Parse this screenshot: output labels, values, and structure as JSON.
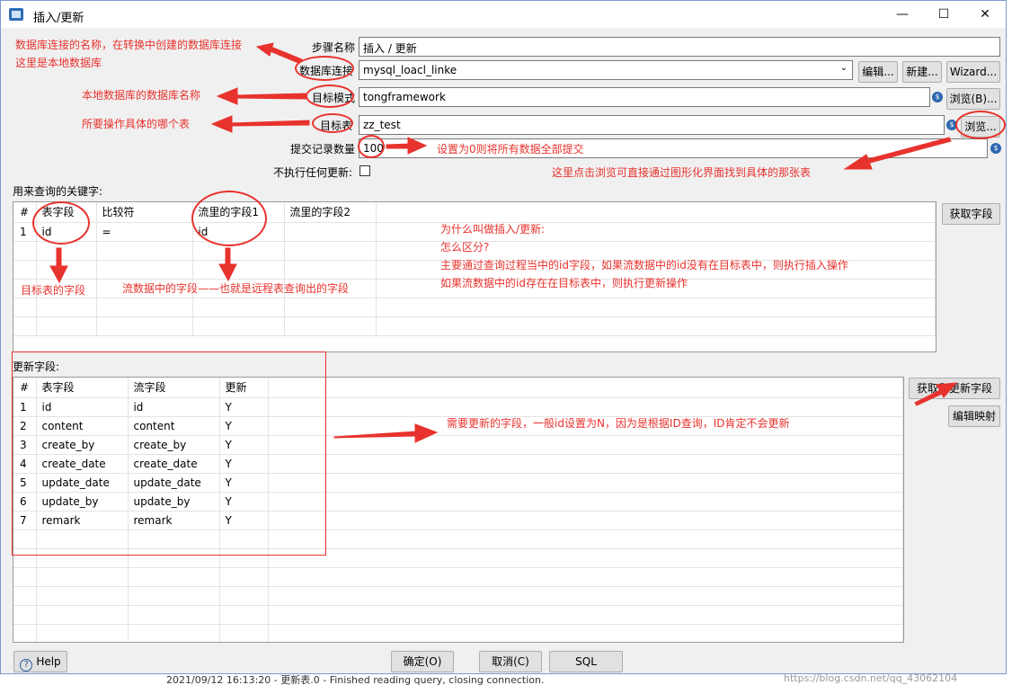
{
  "window": {
    "title": "插入/更新",
    "controls": {
      "minimize": "—",
      "maximize": "☐",
      "close": "✕"
    }
  },
  "form": {
    "step_name_label": "步骤名称",
    "step_name_value": "插入 / 更新",
    "connection_label": "数据库连接",
    "connection_value": "mysql_loacl_linke",
    "edit_button": "编辑...",
    "new_button": "新建...",
    "wizard_button": "Wizard...",
    "schema_label": "目标模式",
    "schema_value": "tongframework",
    "browse_schema_button": "浏览(B)...",
    "table_label": "目标表",
    "table_value": "zz_test",
    "browse_table_button": "浏览...",
    "commit_label": "提交记录数量",
    "commit_value": "100",
    "no_update_label": "不执行任何更新:",
    "no_update_checked": false
  },
  "keys_section": {
    "title": "用来查询的关键字:",
    "get_fields_button": "获取字段",
    "headers": [
      "#",
      "表字段",
      "比较符",
      "流里的字段1",
      "流里的字段2"
    ],
    "rows": [
      [
        "1",
        "id",
        "=",
        "id",
        ""
      ]
    ]
  },
  "update_section": {
    "title": "更新字段:",
    "get_update_fields_button": "获取和更新字段",
    "edit_mapping_button": "编辑映射",
    "headers": [
      "#",
      "表字段",
      "流字段",
      "更新"
    ],
    "rows": [
      [
        "1",
        "id",
        "id",
        "Y"
      ],
      [
        "2",
        "content",
        "content",
        "Y"
      ],
      [
        "3",
        "create_by",
        "create_by",
        "Y"
      ],
      [
        "4",
        "create_date",
        "create_date",
        "Y"
      ],
      [
        "5",
        "update_date",
        "update_date",
        "Y"
      ],
      [
        "6",
        "update_by",
        "update_by",
        "Y"
      ],
      [
        "7",
        "remark",
        "remark",
        "Y"
      ]
    ]
  },
  "footer": {
    "help_button": "Help",
    "ok_button": "确定(O)",
    "cancel_button": "取消(C)",
    "sql_button": "SQL"
  },
  "annotations": {
    "a1_line1": "数据库连接的名称，在转换中创建的数据库连接",
    "a1_line2": "这里是本地数据库",
    "a2": "本地数据库的数据库名称",
    "a3": "所要操作具体的哪个表",
    "a4": "设置为0则将所有数据全部提交",
    "a5": "这里点击浏览可直接通过图形化界面找到具体的那张表",
    "a6": "目标表的字段",
    "a7": "流数据中的字段——也就是远程表查询出的字段",
    "a8_lines": [
      "为什么叫做插入/更新:",
      "怎么区分?",
      "主要通过查询过程当中的id字段，如果流数据中的id没有在目标表中，则执行插入操作",
      "如果流数据中的id存在在目标表中，则执行更新操作"
    ],
    "a9": "需要更新的字段，一般id设置为N，因为是根据ID查询，ID肯定不会更新",
    "accent_color": "#e8322d"
  },
  "background": {
    "log_line": "2021/09/12 16:13:20 - 更新表.0 - Finished reading query, closing connection.",
    "watermark": "https://blog.csdn.net/qq_43062104"
  }
}
